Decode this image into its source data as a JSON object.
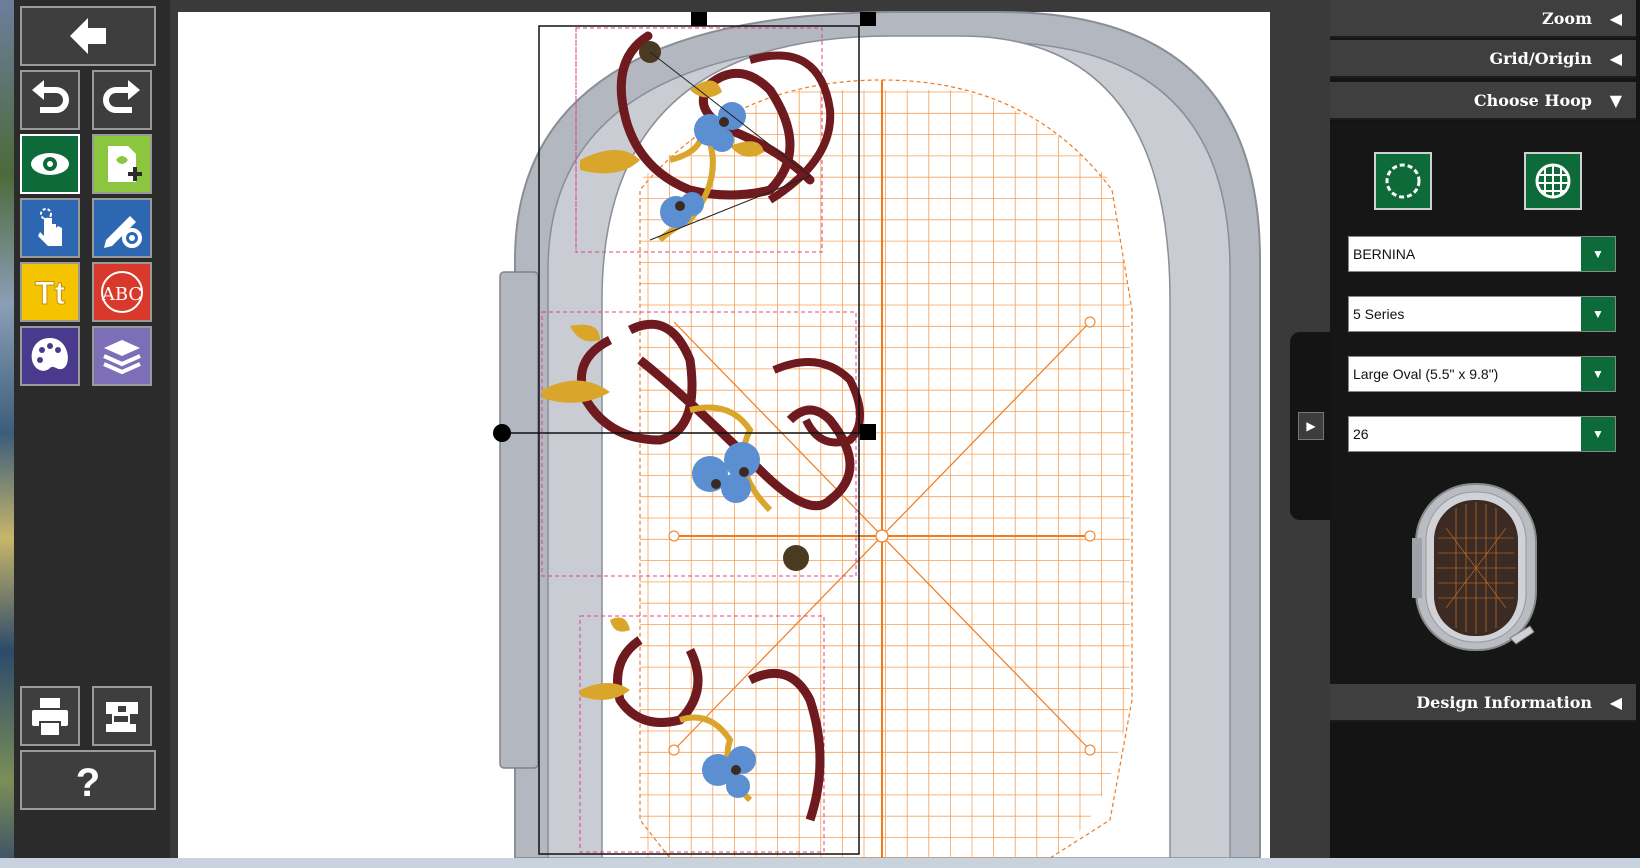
{
  "toolbar": {
    "buttons": [
      {
        "name": "back-arrow-icon"
      },
      {
        "name": "undo-icon"
      },
      {
        "name": "redo-icon"
      },
      {
        "name": "eye-icon"
      },
      {
        "name": "add-design-icon"
      },
      {
        "name": "touch-select-icon"
      },
      {
        "name": "edit-tools-icon"
      },
      {
        "name": "text-tt-icon",
        "label": "Tt"
      },
      {
        "name": "monogram-abc-icon",
        "label": "ABC"
      },
      {
        "name": "palette-icon"
      },
      {
        "name": "layers-icon"
      },
      {
        "name": "print-icon"
      },
      {
        "name": "sewing-machine-icon"
      },
      {
        "name": "help-icon",
        "label": "?"
      }
    ],
    "colors": {
      "bg": "#2b2b2b",
      "green": "#0d6b3a",
      "blue": "#2e67b1",
      "yellow": "#f5c400",
      "red": "#d8392b",
      "purple": "#4a3a8e",
      "lavender": "#7c6fb8",
      "lightgreen": "#8cc63f",
      "gray": "#3e3e3e"
    }
  },
  "panel": {
    "zoom_label": "Zoom",
    "zoom_arrow": "◀",
    "grid_label": "Grid/Origin",
    "grid_arrow": "◀",
    "choose_hoop_label": "Choose Hoop",
    "choose_hoop_arrow": "▼",
    "design_info_label": "Design Information",
    "design_info_arrow": "◀",
    "dropdowns": {
      "brand": "BERNINA",
      "series": "5 Series",
      "hoop": "Large Oval (5.5\" x 9.8\")",
      "hoop_number": "26"
    },
    "dropdown_arrow": "▼",
    "hoop_buttons": [
      {
        "name": "hoop-circle-icon"
      },
      {
        "name": "hoop-grid-icon"
      }
    ]
  },
  "side_tab": {
    "arrow": "▶"
  },
  "canvas": {
    "colors": {
      "grid": "#f5a15a",
      "axis": "#f07a1f",
      "hoop": "#b3b7c0",
      "thread_red": "#6e1a1f",
      "thread_gold": "#d9a52b",
      "thread_blue": "#5b8fd2",
      "page": "#ffffff",
      "guide": "#e0408a"
    }
  }
}
